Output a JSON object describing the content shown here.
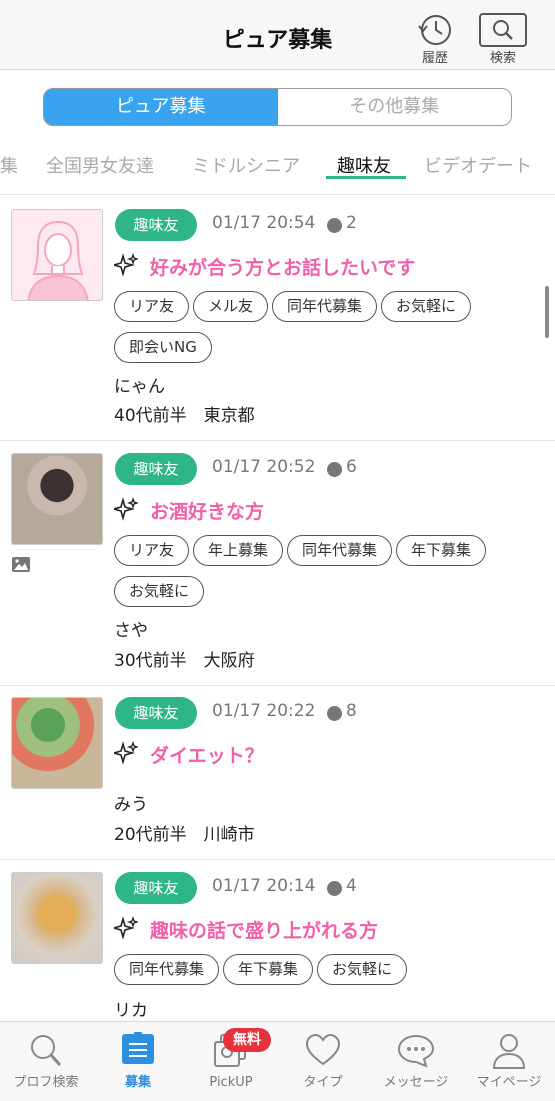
{
  "header": {
    "title": "ピュア募集",
    "history_label": "履歴",
    "search_label": "検索"
  },
  "segment": {
    "active": "ピュア募集",
    "inactive": "その他募集"
  },
  "categories": [
    "集",
    "全国男女友達",
    "ミドルシニア",
    "趣味友",
    "ビデオデート"
  ],
  "active_category": "趣味友",
  "colors": {
    "accent_blue": "#3aa3f0",
    "badge_green": "#2fb58a",
    "title_pink": "#f060a8",
    "free_red": "#e8313d"
  },
  "posts": [
    {
      "category": "趣味友",
      "datetime": "01/17 20:54",
      "views": "2",
      "title": "好みが合う方とお話したいです",
      "tags": [
        "リア友",
        "メル友",
        "同年代募集",
        "お気軽に",
        "即会いNG"
      ],
      "name": "にゃん",
      "info": "40代前半　東京都"
    },
    {
      "category": "趣味友",
      "datetime": "01/17 20:52",
      "views": "6",
      "title": "お酒好きな方",
      "tags": [
        "リア友",
        "年上募集",
        "同年代募集",
        "年下募集",
        "お気軽に"
      ],
      "name": "さや",
      "info": "30代前半　大阪府"
    },
    {
      "category": "趣味友",
      "datetime": "01/17 20:22",
      "views": "8",
      "title": "ダイエット？",
      "tags": [],
      "name": "みう",
      "info": "20代前半　川崎市"
    },
    {
      "category": "趣味友",
      "datetime": "01/17 20:14",
      "views": "4",
      "title": "趣味の話で盛り上がれる方",
      "tags": [
        "同年代募集",
        "年下募集",
        "お気軽に"
      ],
      "name": "リカ",
      "info": ""
    }
  ],
  "tabbar": {
    "items": [
      "プロフ検索",
      "募集",
      "PickUP",
      "タイプ",
      "メッセージ",
      "マイページ"
    ],
    "active": "募集",
    "free_badge": "無料"
  }
}
